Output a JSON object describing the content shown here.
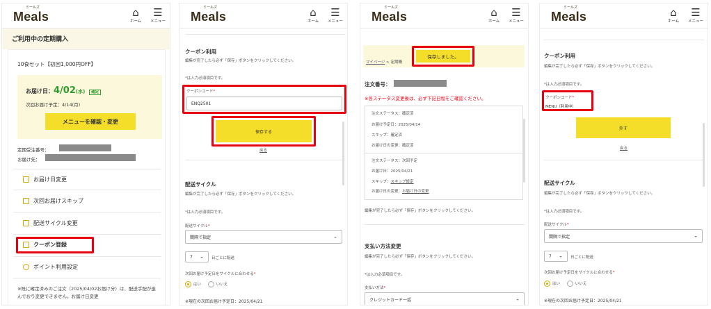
{
  "common": {
    "logo": "Meals",
    "logo_sub": "ミールズ",
    "home_label": "ホーム",
    "menu_label": "メニュー"
  },
  "p1": {
    "title": "ご利用中の定期購入",
    "set_name": "10食セット【初回1,000円OFF】",
    "delivery_label": "お届け日：",
    "delivery_date": "4/02",
    "delivery_dow": "(水)",
    "confirmed": "確定",
    "next_delivery": "次回お届け予定：4/14(月)",
    "menu_button": "メニューを確認・変更",
    "order_no_label": "定期受注番号：",
    "address_label": "お届け先：",
    "menu": [
      "お届け日変更",
      "次回お届けスキップ",
      "配送サイクル変更",
      "クーポン登録",
      "ポイント利用設定"
    ],
    "note": "※既に確定済みのご注文（2025/04/02お届け分）は、配送手配が進んでおり変更できません。お届け日変更"
  },
  "p2": {
    "coupon_title": "クーポン利用",
    "coupon_desc": "編集が完了したら必ず「保存」ボタンをクリックしてください。",
    "required_note": "*は入力必須項目です。",
    "coupon_code_label": "クーポンコード",
    "coupon_code_value": "ENQ2501",
    "save_button": "保存する",
    "back_link": "戻る",
    "cycle_title": "配送サイクル",
    "cycle_desc": "編集が完了したら必ず「保存」ボタンをクリックしてください。",
    "cycle_required": "*は入力必須項目です。",
    "cycle_label": "配送サイクル",
    "cycle_value": "間隔で指定",
    "interval_value": "7",
    "interval_suffix": "日ごとに配送",
    "align_label": "次回お届け予定日をサイクルに合わせる",
    "radio_yes": "はい",
    "radio_no": "いいえ",
    "current_next": "※現在の次回お届け予定日：2025/04/21"
  },
  "p3": {
    "saved_message": "保存しました。",
    "breadcrumb_home": "マイページ",
    "breadcrumb_sep": ">",
    "breadcrumb_current": "定期購",
    "order_label": "注文番号：",
    "warning": "※各ステータス変更後は、必ず下記日程をご確認ください。",
    "box1": [
      "注文ステータス：確定済",
      "お届け予定日：2025/04/14",
      "スキップ：確定済",
      "お届け日の変更：確定済"
    ],
    "box2_status": "注文ステータス：次回予定",
    "box2_date": "お届け日：2025/04/21",
    "box2_skip_label": "スキップ：",
    "box2_skip_link": "スキップ設定",
    "box2_change_label": "お届け日の変更：",
    "box2_change_link": "お届け日の変更",
    "edit_note": "編集が完了したら必ず「保存」ボタンをクリックしてください。",
    "pay_title": "支払い方法変更",
    "pay_desc": "編集が完了したら必ず「保存」ボタンをクリックしてください。",
    "pay_required": "*は入力必須項目です。",
    "pay_label": "支払い方法",
    "pay_value": "クレジットカード一括"
  },
  "p4": {
    "coupon_title": "クーポン利用",
    "coupon_desc": "編集が完了したら必ず「保存」ボタンをクリックしてください。",
    "required_note": "*は入力必須項目です。",
    "coupon_code_label": "クーポンコード",
    "coupon_code_value": "MENU（利用中）",
    "remove_button": "外す",
    "back_link": "戻る",
    "cycle_title": "配送サイクル",
    "cycle_desc": "編集が完了したら必ず「保存」ボタンをクリックしてください。",
    "cycle_required": "*は入力必須項目です。",
    "cycle_label": "配送サイクル",
    "cycle_value": "間隔で指定",
    "interval_value": "7",
    "interval_suffix": "日ごとに配送",
    "align_label": "次回お届け予定日をサイクルに合わせる",
    "radio_yes": "はい",
    "radio_no": "いいえ",
    "current_next": "※現在の次回お届け予定日：2025/04/21"
  },
  "colors": {
    "accent": "#f5de2a",
    "highlight": "#e60012",
    "confirm_green": "#2e9b2e"
  }
}
